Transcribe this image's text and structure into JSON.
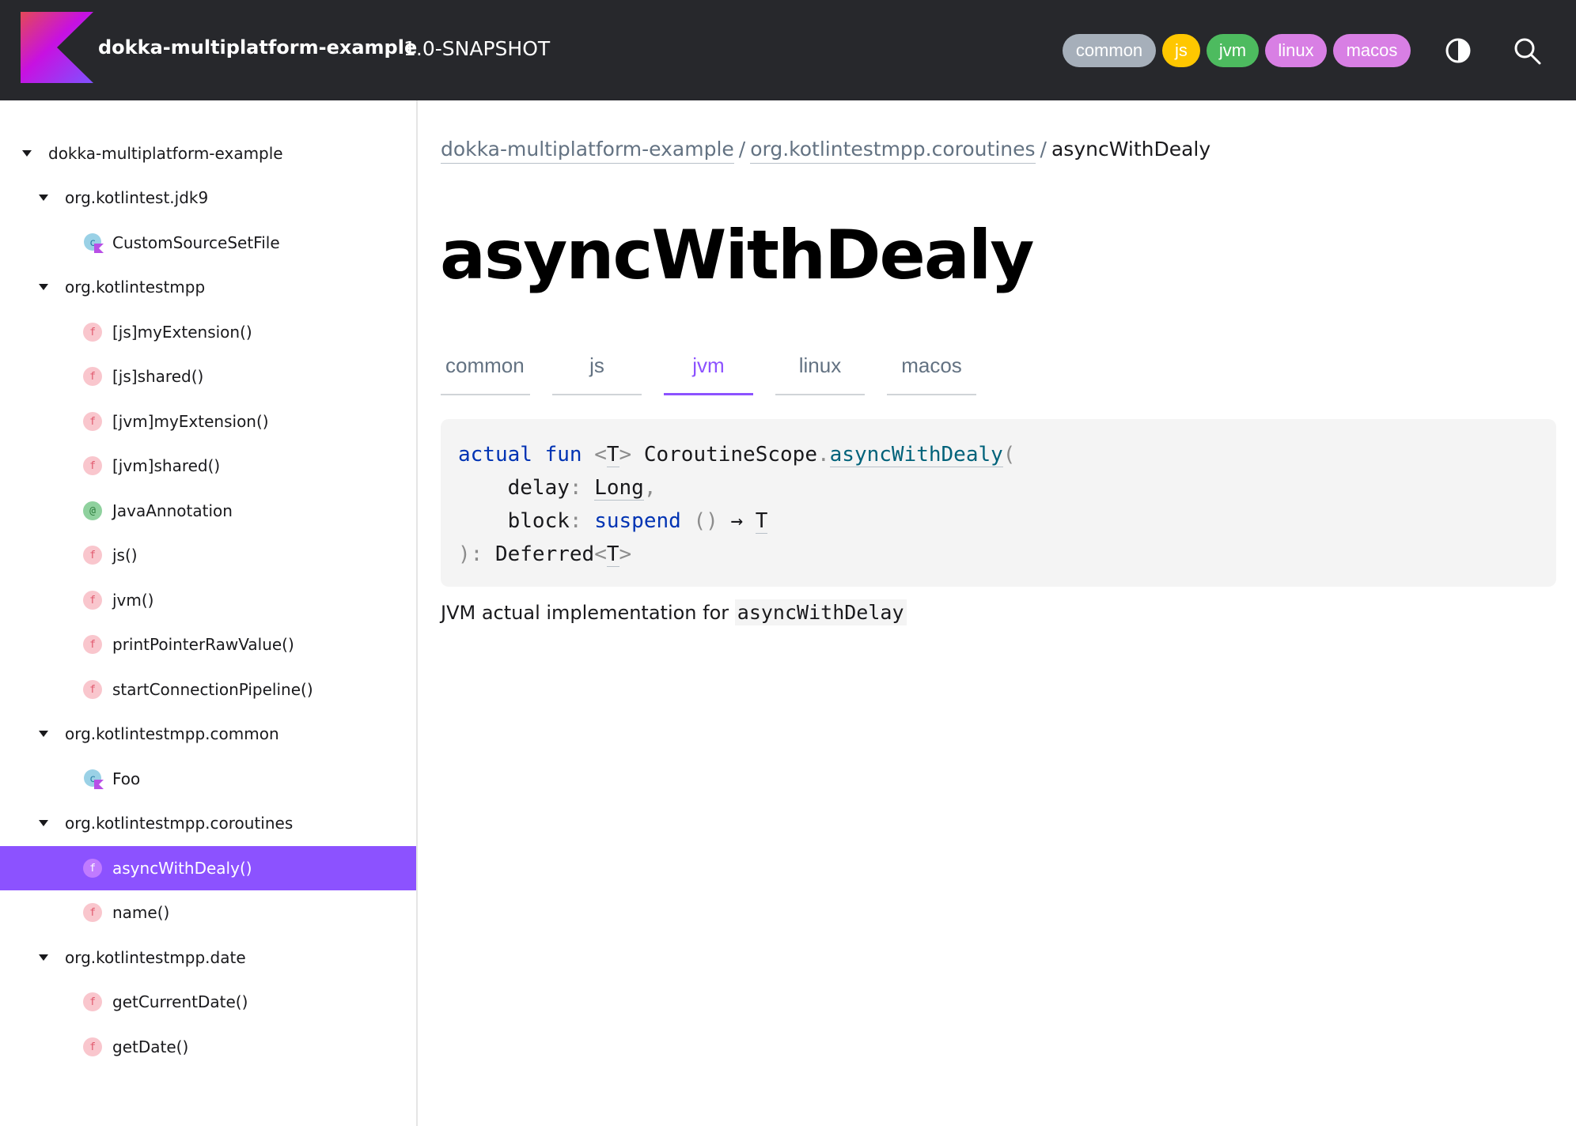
{
  "header": {
    "project_name": "dokka-multiplatform-example",
    "version": "1.0-SNAPSHOT",
    "source_sets": [
      "common",
      "js",
      "jvm",
      "linux",
      "macos"
    ],
    "source_set_colors": {
      "common": "#a6afba",
      "js": "#ffc700",
      "jvm": "#4dbb5f",
      "linux": "#d87fe4",
      "macos": "#d87fe4"
    },
    "theme_toggle_icon": "contrast-icon",
    "search_icon": "search-icon"
  },
  "sidebar": {
    "items": [
      {
        "label": "dokka-multiplatform-example",
        "type": "module",
        "expanded": true
      },
      {
        "label": "org.kotlintest.jdk9",
        "type": "package",
        "expanded": true
      },
      {
        "label": "CustomSourceSetFile",
        "type": "file"
      },
      {
        "label": "org.kotlintestmpp",
        "type": "package",
        "expanded": true
      },
      {
        "label": "[js]myExtension()",
        "type": "function"
      },
      {
        "label": "[js]shared()",
        "type": "function"
      },
      {
        "label": "[jvm]myExtension()",
        "type": "function"
      },
      {
        "label": "[jvm]shared()",
        "type": "function"
      },
      {
        "label": "JavaAnnotation",
        "type": "annotation"
      },
      {
        "label": "js()",
        "type": "function"
      },
      {
        "label": "jvm()",
        "type": "function"
      },
      {
        "label": "printPointerRawValue()",
        "type": "function"
      },
      {
        "label": "startConnectionPipeline()",
        "type": "function"
      },
      {
        "label": "org.kotlintestmpp.common",
        "type": "package",
        "expanded": true
      },
      {
        "label": "Foo",
        "type": "file"
      },
      {
        "label": "org.kotlintestmpp.coroutines",
        "type": "package",
        "expanded": true
      },
      {
        "label": "asyncWithDealy()",
        "type": "function",
        "selected": true
      },
      {
        "label": "name()",
        "type": "function"
      },
      {
        "label": "org.kotlintestmpp.date",
        "type": "package",
        "expanded": true
      },
      {
        "label": "getCurrentDate()",
        "type": "function"
      },
      {
        "label": "getDate()",
        "type": "function"
      }
    ],
    "function_icon_letter": "f",
    "annotation_icon_letter": "@",
    "selected_color": "#8c52ff"
  },
  "breadcrumb": {
    "items": [
      "dokka-multiplatform-example",
      "org.kotlintestmpp.coroutines"
    ],
    "separator": "/",
    "current": "asyncWithDealy"
  },
  "main": {
    "title": "asyncWithDealy",
    "tabs": [
      "common",
      "js",
      "jvm",
      "linux",
      "macos"
    ],
    "active_tab": "jvm",
    "signature": {
      "kw_actual": "actual",
      "kw_fun": "fun",
      "type_param": "T",
      "receiver": "CoroutineScope",
      "dot": ".",
      "fn_name": "asyncWithDealy",
      "open_paren": "(",
      "param1_name": "delay",
      "colon": ":",
      "param1_type": "Long",
      "comma": ",",
      "param2_name": "block",
      "kw_suspend": "suspend",
      "empty_parens": "()",
      "arrow": "→",
      "close": ")",
      "return_type": "Deferred"
    },
    "description_text": "JVM actual implementation for ",
    "description_code": "asyncWithDelay"
  }
}
